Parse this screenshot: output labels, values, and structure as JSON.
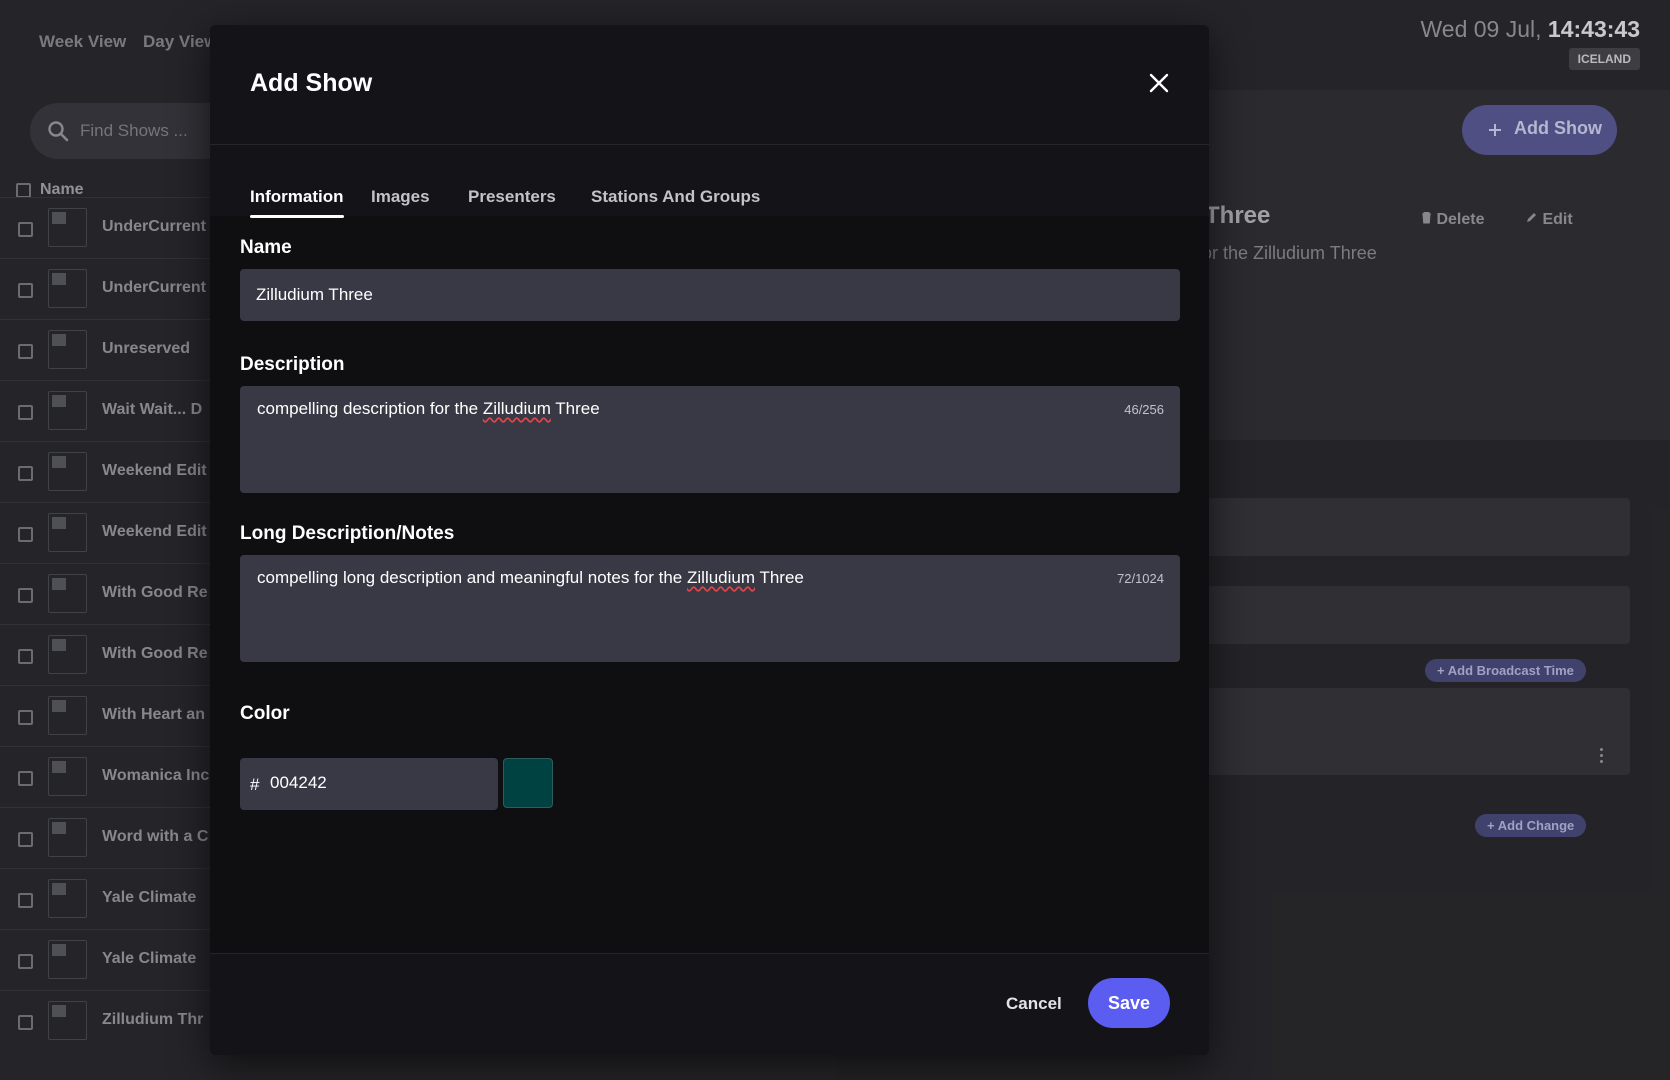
{
  "app": {
    "view_tabs": [
      "Week View",
      "Day View"
    ],
    "clock_date": "Wed 09 Jul,",
    "clock_time": "14:43:43",
    "timezone": "ICELAND",
    "search_placeholder": "Find Shows ...",
    "list_header": "Name",
    "shows": [
      "UnderCurrent",
      "UnderCurrent",
      "Unreserved",
      "Wait Wait... D",
      "Weekend Edit",
      "Weekend Edit",
      "With Good Re",
      "With Good Re",
      "With Heart an",
      "Womanica Inc",
      "Word with a C",
      "Yale Climate",
      "Yale Climate",
      "Zilludium Thr"
    ],
    "add_show_button": "Add Show",
    "detail_title": "Three",
    "detail_description": "for the Zilludium Three",
    "delete_label": "Delete",
    "edit_label": "Edit",
    "add_broadcast_time": "Add Broadcast Time",
    "add_change": "Add Change"
  },
  "modal": {
    "title": "Add Show",
    "tabs": [
      "Information",
      "Images",
      "Presenters",
      "Stations And Groups"
    ],
    "active_tab": "Information",
    "name": {
      "label": "Name",
      "value": "Zilludium Three"
    },
    "description": {
      "label": "Description",
      "value_before": "compelling description for the ",
      "value_misspelled": "Zilludium",
      "value_after": " Three",
      "counter": "46/256"
    },
    "long_description": {
      "label": "Long Description/Notes",
      "value_before": "compelling long description and meaningful notes for the ",
      "value_misspelled": "Zilludium",
      "value_after": " Three",
      "counter": "72/1024"
    },
    "color": {
      "label": "Color",
      "hash": "#",
      "value": "004242",
      "swatch": "#004242"
    },
    "cancel_label": "Cancel",
    "save_label": "Save"
  },
  "colors": {
    "accent": "#5b5cf0",
    "modal_bg": "#0f0f12",
    "field_bg": "#393946"
  }
}
